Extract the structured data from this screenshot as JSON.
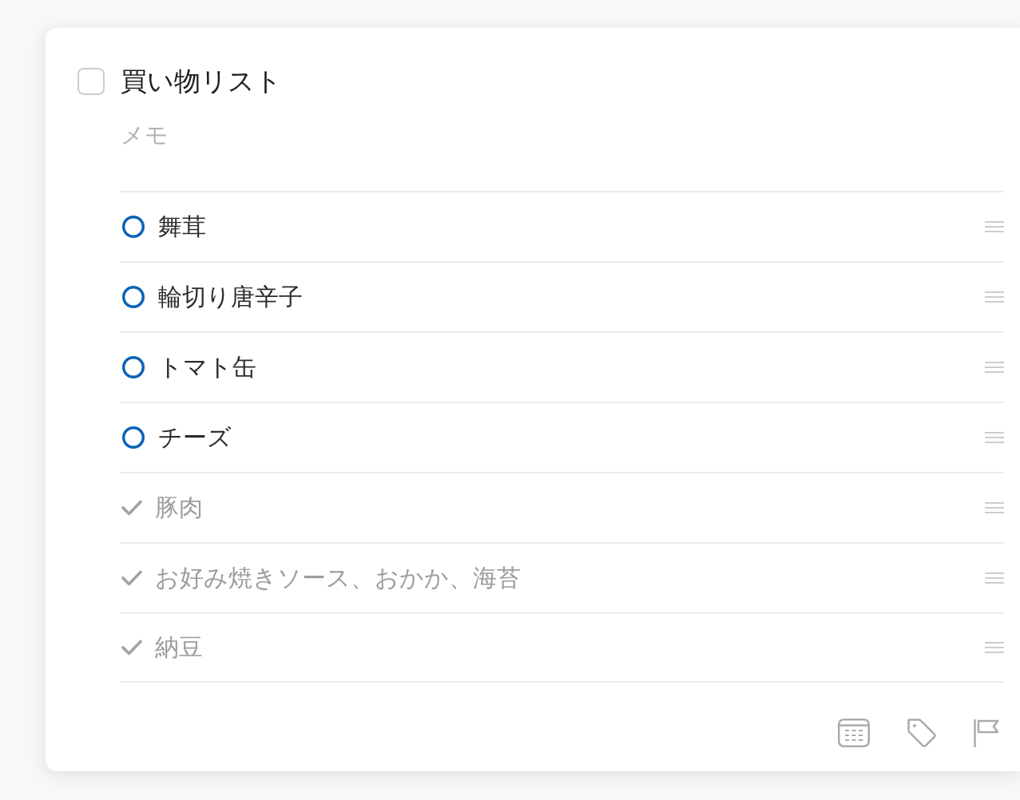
{
  "reminder": {
    "title": "買い物リスト",
    "checked": false,
    "notes": {
      "placeholder": "メモ"
    }
  },
  "subtasks": [
    {
      "text": "舞茸",
      "checked": false
    },
    {
      "text": "輪切り唐辛子",
      "checked": false
    },
    {
      "text": "トマト缶",
      "checked": false
    },
    {
      "text": "チーズ",
      "checked": false
    },
    {
      "text": "豚肉",
      "checked": true
    },
    {
      "text": "お好み焼きソース、おかか、海苔",
      "checked": true
    },
    {
      "text": "納豆",
      "checked": true
    }
  ]
}
